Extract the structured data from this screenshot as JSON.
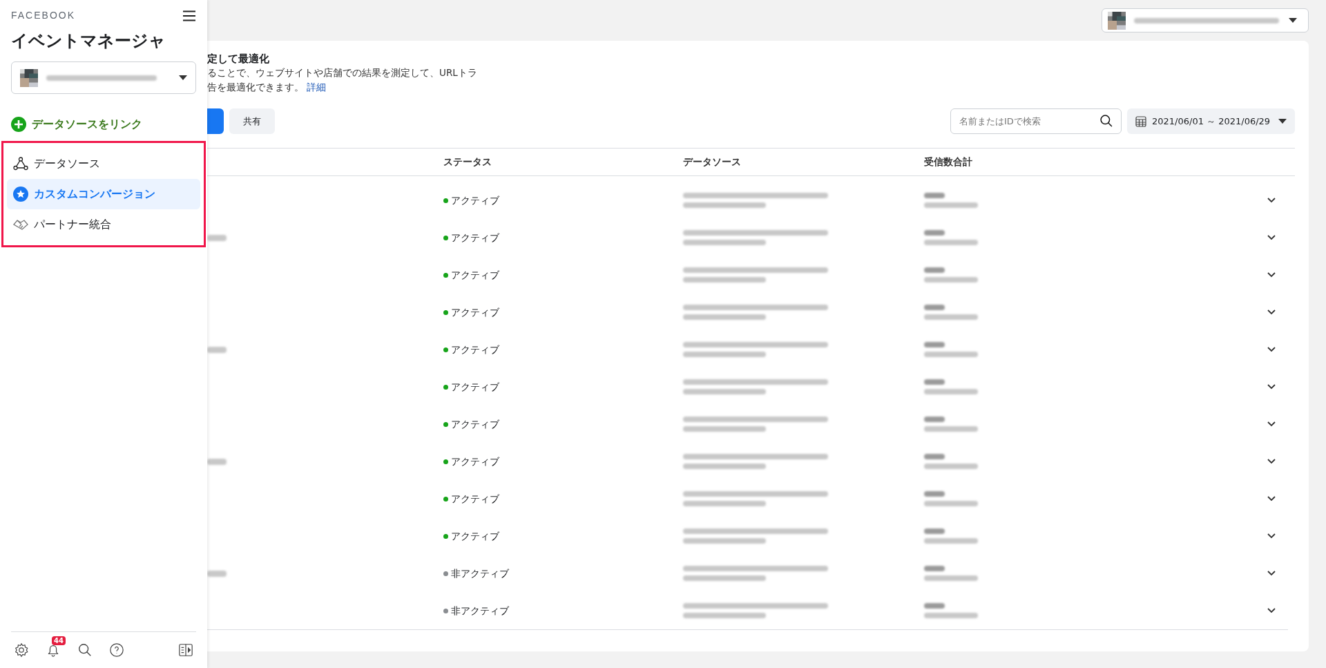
{
  "sidebar": {
    "brand": "FACEBOOK",
    "title": "イベントマネージャ",
    "link_action": "データソースをリンク",
    "nav": [
      {
        "label": "データソース",
        "kind": "nodes",
        "selected": false
      },
      {
        "label": "カスタムコンバージョン",
        "kind": "star",
        "selected": true
      },
      {
        "label": "パートナー統合",
        "kind": "handshake",
        "selected": false
      }
    ],
    "notification_count": "44"
  },
  "banner": {
    "title": "定して最適化",
    "lines": [
      "ることで、ウェブサイトや店舗での結果を測定して、URLトラ",
      "告を最適化できます。"
    ],
    "link": "詳細"
  },
  "share_button": "共有",
  "search": {
    "placeholder": "名前またはIDで検索"
  },
  "date_range": "2021/06/01 ～ 2021/06/29",
  "table": {
    "columns": [
      "ステータス",
      "データソース",
      "受信数合計"
    ],
    "rows": [
      {
        "status": "アクティブ",
        "active": true
      },
      {
        "status": "アクティブ",
        "active": true
      },
      {
        "status": "アクティブ",
        "active": true
      },
      {
        "status": "アクティブ",
        "active": true
      },
      {
        "status": "アクティブ",
        "active": true
      },
      {
        "status": "アクティブ",
        "active": true
      },
      {
        "status": "アクティブ",
        "active": true
      },
      {
        "status": "アクティブ",
        "active": true
      },
      {
        "status": "アクティブ",
        "active": true
      },
      {
        "status": "アクティブ",
        "active": true
      },
      {
        "status": "非アクティブ",
        "active": false
      },
      {
        "status": "非アクティブ",
        "active": false
      }
    ]
  }
}
